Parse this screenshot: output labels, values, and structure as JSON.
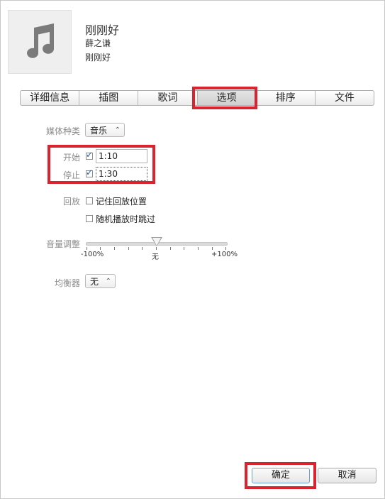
{
  "header": {
    "title": "刚刚好",
    "artist": "薛之谦",
    "album": "刚刚好",
    "artwork_icon": "music-note-icon"
  },
  "tabs": [
    {
      "label": "详细信息",
      "active": false
    },
    {
      "label": "插图",
      "active": false
    },
    {
      "label": "歌词",
      "active": false
    },
    {
      "label": "选项",
      "active": true
    },
    {
      "label": "排序",
      "active": false
    },
    {
      "label": "文件",
      "active": false
    }
  ],
  "options": {
    "media_kind_label": "媒体种类",
    "media_kind_value": "音乐",
    "start_label": "开始",
    "start_checked": true,
    "start_value": "1:10",
    "stop_label": "停止",
    "stop_checked": true,
    "stop_value": "1:30",
    "playback_label": "回放",
    "remember_position_label": "记住回放位置",
    "remember_position_checked": false,
    "skip_shuffle_label": "随机播放时跳过",
    "skip_shuffle_checked": false,
    "volume_label": "音量调整",
    "volume_min_label": "-100%",
    "volume_mid_label": "无",
    "volume_max_label": "+100%",
    "volume_level_percent": 0,
    "eq_label": "均衡器",
    "eq_value": "无"
  },
  "buttons": {
    "ok_label": "确定",
    "cancel_label": "取消"
  },
  "colors": {
    "highlight": "#d9232e",
    "check": "#1e5bb5"
  }
}
